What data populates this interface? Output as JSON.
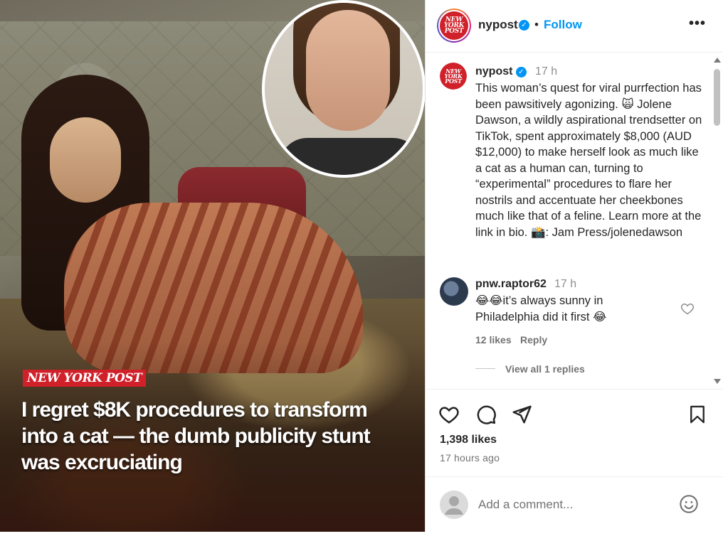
{
  "media": {
    "brand_tag": "NEW YORK POST",
    "headline": "I regret $8K procedures to transform into a cat — the dumb publicity stunt was excruciating"
  },
  "header": {
    "avatar_text_lines": [
      "NEW",
      "YORK",
      "POST"
    ],
    "username": "nypost",
    "separator": "•",
    "follow_label": "Follow",
    "more_label": "•••"
  },
  "caption": {
    "username": "nypost",
    "time": "17 h",
    "text": "This woman’s quest for viral purrfection has been pawsitively agonizing. 🙀 Jolene Dawson, a wildly aspirational trendsetter on TikTok, spent approximately $8,000 (AUD $12,000) to make herself look as much like a cat as a human can, turning to “experimental” procedures to flare her nostrils and accentuate her cheekbones much like that of a feline. Learn more at the link in bio. 📸: Jam Press/jolenedawson"
  },
  "comment": {
    "username": "pnw.raptor62",
    "time": "17 h",
    "text": "😂😂it’s always sunny in Philadelphia did it first 😂",
    "likes": "12 likes",
    "reply_label": "Reply",
    "view_replies": "View all 1 replies"
  },
  "post": {
    "likes": "1,398 likes",
    "time_ago": "17 hours ago"
  },
  "add_comment": {
    "placeholder": "Add a comment..."
  },
  "colors": {
    "accent_blue": "#0095f6",
    "np_red": "#d0202a",
    "muted_text": "#737373"
  }
}
